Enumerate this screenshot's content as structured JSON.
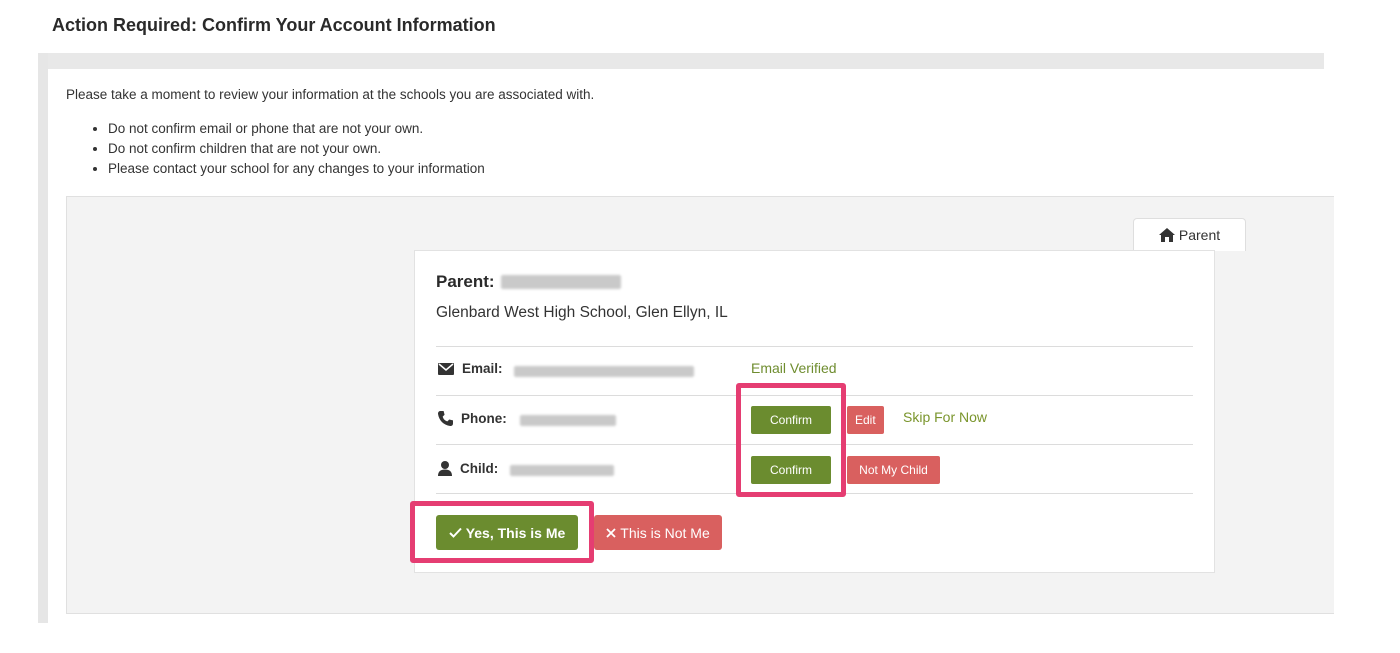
{
  "page": {
    "title": "Action Required: Confirm Your Account Information"
  },
  "intro": {
    "text": "Please take a moment to review your information at the schools you are associated with.",
    "rules": [
      "Do not confirm email or phone that are not your own.",
      "Do not confirm children that are not your own.",
      "Please contact your school for any changes to your information"
    ]
  },
  "tab": {
    "label": "Parent",
    "icon": "home-icon"
  },
  "card": {
    "parent_label": "Parent:",
    "school": "Glenbard West High School, Glen Ellyn, IL",
    "rows": [
      {
        "icon": "envelope-icon",
        "label": "Email:",
        "status": "Email Verified"
      },
      {
        "icon": "phone-icon",
        "label": "Phone:",
        "confirm": "Confirm",
        "edit": "Edit",
        "skip": "Skip For Now"
      },
      {
        "icon": "user-icon",
        "label": "Child:",
        "confirm": "Confirm",
        "not_my_child": "Not My Child"
      }
    ],
    "yes_button": "Yes, This is Me",
    "no_button": "This is Not Me"
  },
  "colors": {
    "confirm_green": "#6b8c2f",
    "reject_red": "#d9605f",
    "highlight_pink": "#e53d72",
    "verified_green": "#6f8d2f"
  }
}
